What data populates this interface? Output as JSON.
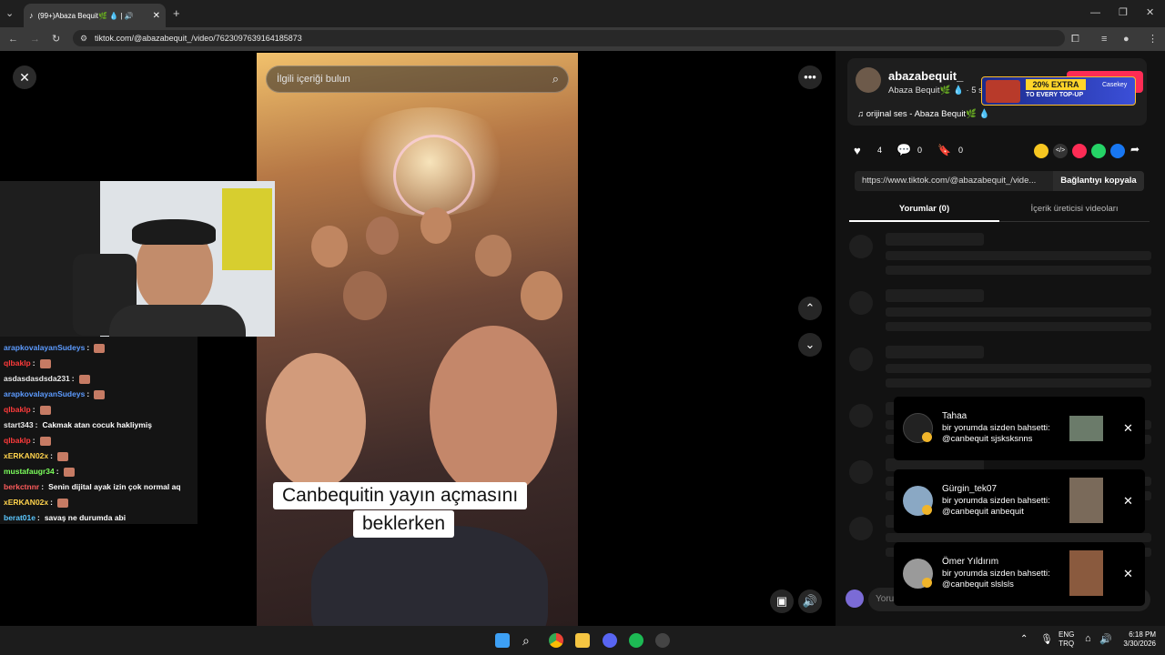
{
  "browser": {
    "tab_title": "(99+)Abaza Bequit🌿 💧 | 🔊",
    "url": "tiktok.com/@abazabequit_/video/7623097639164185873"
  },
  "video": {
    "search_placeholder": "İlgili içeriği bulun",
    "caption_line1": "Canbequitin yayın açmasını",
    "caption_line2": "beklerken"
  },
  "chat": [
    {
      "user": "arapkovalayanSudeys",
      "color": "#5c9bff",
      "msg": ""
    },
    {
      "user": "qlbaklp",
      "color": "#ff3b3b",
      "msg": ""
    },
    {
      "user": "asdasdasdsda231",
      "color": "#e9e9e9",
      "msg": ""
    },
    {
      "user": "arapkovalayanSudeys",
      "color": "#5c9bff",
      "msg": ""
    },
    {
      "user": "qlbaklp",
      "color": "#ff3b3b",
      "msg": ""
    },
    {
      "user": "start343",
      "color": "#e9e9e9",
      "msg": "Cakmak atan cocuk hakliymiş"
    },
    {
      "user": "qlbaklp",
      "color": "#ff3b3b",
      "msg": ""
    },
    {
      "user": "xERKAN02x",
      "color": "#ffd34d",
      "msg": ""
    },
    {
      "user": "mustafaugr34",
      "color": "#7cff5c",
      "msg": ""
    },
    {
      "user": "berkctnnr",
      "color": "#ff5c5c",
      "msg": "Senin dijital ayak izin çok normal aq"
    },
    {
      "user": "xERKAN02x",
      "color": "#ffd34d",
      "msg": ""
    },
    {
      "user": "berat01e",
      "color": "#5cc8ff",
      "msg": "savaş ne durumda abi"
    }
  ],
  "profile": {
    "username": "abazabequit_",
    "display_name": "Abaza Bequit🌿 💧 · 5 s",
    "follow_label": "Geri takip et",
    "music": "orijinal ses - Abaza Bequit🌿 💧",
    "likes": "4",
    "comments": "0",
    "saves": "0",
    "ad_text": "20% EXTRA",
    "ad_sub": "TO EVERY TOP-UP",
    "ad_brand": "Casekey"
  },
  "share": {
    "link": "https://www.tiktok.com/@abazabequit_/vide...",
    "copy_label": "Bağlantıyı kopyala"
  },
  "tabs": {
    "comments": "Yorumlar (0)",
    "creator_videos": "İçerik üreticisi videoları"
  },
  "comment_input_placeholder": "Yoru",
  "notifications": [
    {
      "name": "Tahaa",
      "line1": "bir yorumda sizden bahsetti:",
      "line2": "@canbequit sjsksksnns"
    },
    {
      "name": "Gürgin_tek07",
      "line1": "bir yorumda sizden bahsetti:",
      "line2": "@canbequit anbequit"
    },
    {
      "name": "Ömer Yıldırım",
      "line1": "bir yorumda sizden bahsetti:",
      "line2": "@canbequit slslsls"
    }
  ],
  "taskbar": {
    "lang1": "ENG",
    "lang2": "TRQ",
    "time": "6:18 PM",
    "date": "3/30/2026"
  }
}
